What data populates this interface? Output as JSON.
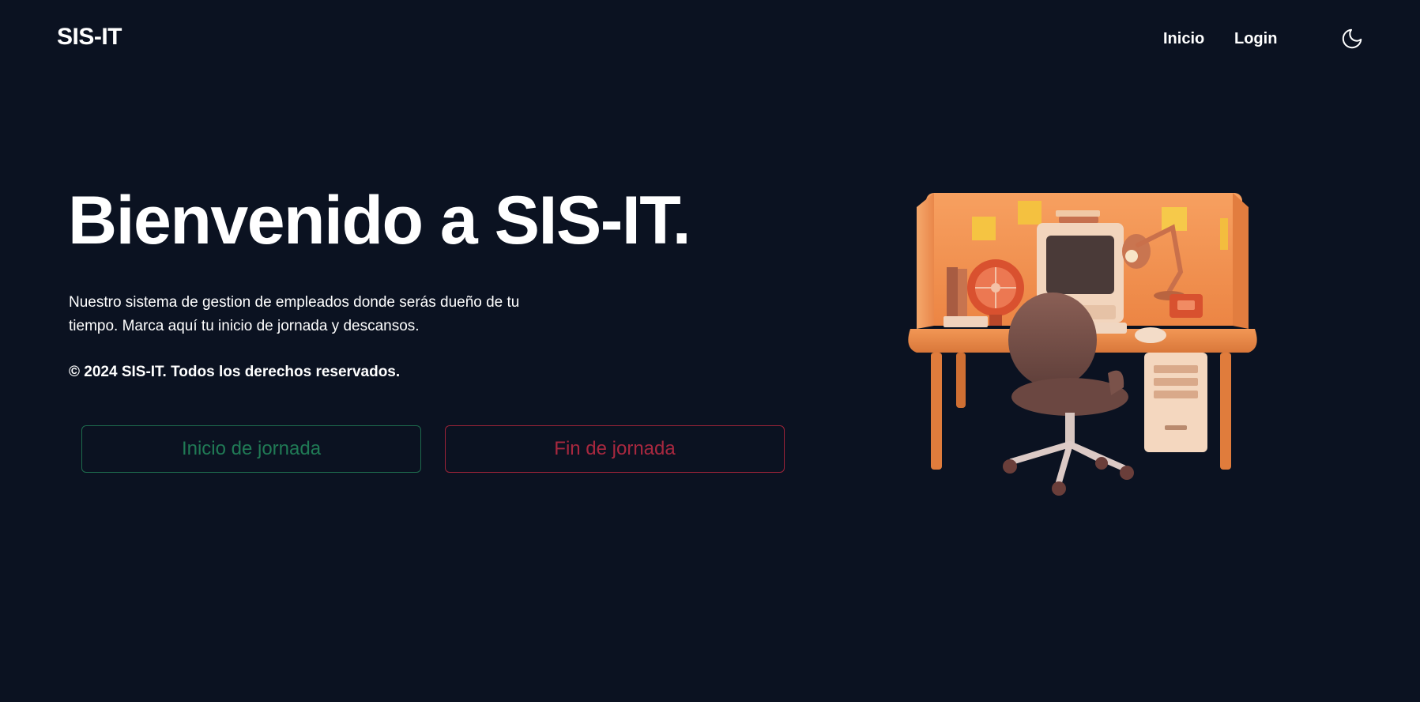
{
  "header": {
    "brand": "SIS-IT",
    "nav": {
      "inicio": "Inicio",
      "login": "Login"
    },
    "theme_toggle_icon": "moon-icon"
  },
  "hero": {
    "title": "Bienvenido a SIS-IT.",
    "description": "Nuestro sistema de gestion de empleados donde serás dueño de tu tiempo. Marca aquí tu inicio de jornada y descansos.",
    "copyright": "© 2024 SIS-IT. Todos los derechos reservados."
  },
  "actions": {
    "start_label": "Inicio de jornada",
    "end_label": "Fin de jornada"
  },
  "colors": {
    "background": "#0b1221",
    "text": "#ffffff",
    "start_accent": "#207a55",
    "end_accent": "#a8283f"
  }
}
